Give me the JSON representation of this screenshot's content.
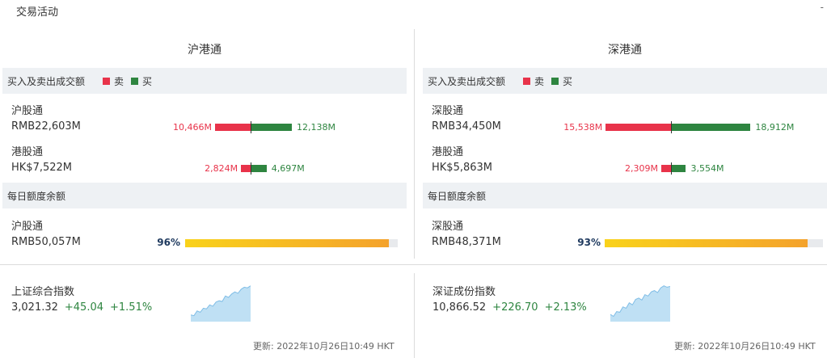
{
  "header": {
    "title": "交易活动",
    "dash": "-"
  },
  "legend": {
    "sell": "卖",
    "buy": "买"
  },
  "colors": {
    "sell": "#e8334a",
    "buy": "#2e8540",
    "quota_start": "#f9d21b",
    "quota_end": "#f4a22c",
    "spark": "#bfe0f4"
  },
  "panels": [
    {
      "title": "沪港通",
      "trade_label": "买入及卖出成交额",
      "rows": [
        {
          "name": "沪股通",
          "value": "RMB22,603M",
          "sell": 10466,
          "buy": 12138,
          "sell_label": "10,466M",
          "buy_label": "12,138M"
        },
        {
          "name": "港股通",
          "value": "HK$7,522M",
          "sell": 2824,
          "buy": 4697,
          "sell_label": "2,824M",
          "buy_label": "4,697M"
        }
      ],
      "quota_label": "每日额度余额",
      "quota": {
        "name": "沪股通",
        "value": "RMB50,057M",
        "pct_label": "96%",
        "pct": 96
      }
    },
    {
      "title": "深港通",
      "trade_label": "买入及卖出成交额",
      "rows": [
        {
          "name": "深股通",
          "value": "RMB34,450M",
          "sell": 15538,
          "buy": 18912,
          "sell_label": "15,538M",
          "buy_label": "18,912M"
        },
        {
          "name": "港股通",
          "value": "HK$5,863M",
          "sell": 2309,
          "buy": 3554,
          "sell_label": "2,309M",
          "buy_label": "3,554M"
        }
      ],
      "quota_label": "每日额度余额",
      "quota": {
        "name": "深股通",
        "value": "RMB48,371M",
        "pct_label": "93%",
        "pct": 93
      }
    }
  ],
  "indices": [
    {
      "name": "上证综合指数",
      "value": "3,021.32",
      "change": "+45.04",
      "pct": "+1.51%",
      "spark": [
        0.1,
        0.08,
        0.22,
        0.18,
        0.3,
        0.28,
        0.4,
        0.36,
        0.48,
        0.52,
        0.5,
        0.66,
        0.62,
        0.72,
        0.78,
        0.74,
        0.86,
        0.92,
        0.9,
        0.96
      ]
    },
    {
      "name": "深证成份指数",
      "value": "10,866.52",
      "change": "+226.70",
      "pct": "+2.13%",
      "spark": [
        0.12,
        0.06,
        0.2,
        0.18,
        0.34,
        0.3,
        0.46,
        0.4,
        0.56,
        0.6,
        0.54,
        0.7,
        0.66,
        0.78,
        0.82,
        0.76,
        0.9,
        0.96,
        0.92,
        0.94
      ]
    }
  ],
  "updated": "更新: 2022年10月26日10:49 HKT"
}
